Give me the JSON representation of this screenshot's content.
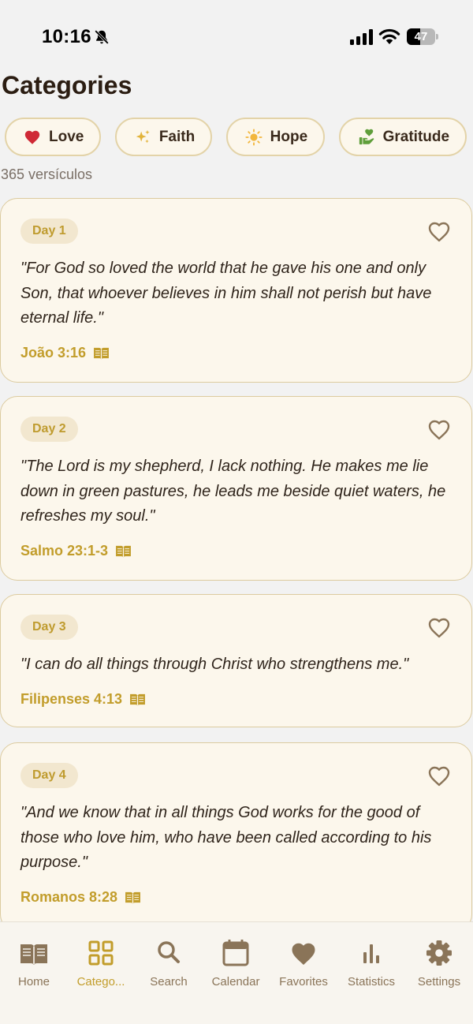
{
  "status_bar": {
    "time": "10:16",
    "battery": "47",
    "battery_level": 0.47
  },
  "title": "Categories",
  "categories": [
    {
      "label": "Love",
      "icon": "heart-icon"
    },
    {
      "label": "Faith",
      "icon": "sparkles-icon"
    },
    {
      "label": "Hope",
      "icon": "sun-icon"
    },
    {
      "label": "Gratitude",
      "icon": "hand-heart-icon"
    }
  ],
  "verse_count": "365 versículos",
  "verses": [
    {
      "day": "Day 1",
      "text": "\"For God so loved the world that he gave his one and only Son, that whoever believes in him shall not perish but have eternal life.\"",
      "reference": "João 3:16"
    },
    {
      "day": "Day 2",
      "text": "\"The Lord is my shepherd, I lack nothing. He makes me lie down in green pastures, he leads me beside quiet waters, he refreshes my soul.\"",
      "reference": "Salmo 23:1-3"
    },
    {
      "day": "Day 3",
      "text": "\"I can do all things through Christ who strengthens me.\"",
      "reference": "Filipenses 4:13"
    },
    {
      "day": "Day 4",
      "text": "\"And we know that in all things God works for the good of those who love him, who have been called according to his purpose.\"",
      "reference": "Romanos 8:28"
    }
  ],
  "tabs": [
    {
      "label": "Home",
      "icon": "book-icon"
    },
    {
      "label": "Catego...",
      "icon": "grid-icon",
      "active": true
    },
    {
      "label": "Search",
      "icon": "search-icon"
    },
    {
      "label": "Calendar",
      "icon": "calendar-icon"
    },
    {
      "label": "Favorites",
      "icon": "heart-icon"
    },
    {
      "label": "Statistics",
      "icon": "bar-chart-icon"
    },
    {
      "label": "Settings",
      "icon": "gear-icon"
    }
  ],
  "colors": {
    "background": "#f2f2f2",
    "card_background": "#fcf7ec",
    "card_border": "#dccb9f",
    "accent_gold": "#c29d2b",
    "brown": "#8a7458",
    "title": "#2b1d12"
  }
}
